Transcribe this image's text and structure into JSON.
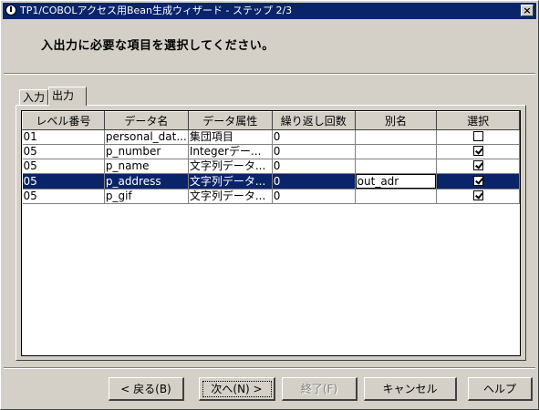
{
  "window": {
    "title": "TP1/COBOLアクセス用Bean生成ウィザード - ステップ 2/3",
    "close_label": "×"
  },
  "instruction": "入出力に必要な項目を選択してください。",
  "tabs": [
    {
      "label": "入力",
      "active": false
    },
    {
      "label": "出力",
      "active": true
    }
  ],
  "table": {
    "columns": [
      "レベル番号",
      "データ名",
      "データ属性",
      "繰り返し回数",
      "別名",
      "選択"
    ],
    "rows": [
      {
        "level": "01",
        "name": "personal_dat...",
        "attr": "集団項目",
        "repeat": "0",
        "alias": "",
        "checked": false
      },
      {
        "level": "05",
        "name": "p_number",
        "attr": "Integerデー...",
        "repeat": "0",
        "alias": "",
        "checked": true
      },
      {
        "level": "05",
        "name": "p_name",
        "attr": "文字列データ...",
        "repeat": "0",
        "alias": "",
        "checked": true
      },
      {
        "level": "05",
        "name": "p_address",
        "attr": "文字列データ...",
        "repeat": "0",
        "alias": "out_adr",
        "checked": true,
        "selected": true
      },
      {
        "level": "05",
        "name": "p_gif",
        "attr": "文字列データ...",
        "repeat": "0",
        "alias": "",
        "checked": true
      }
    ]
  },
  "buttons": {
    "back": "< 戻る(B)",
    "next": "次へ(N) >",
    "finish": "終了(F)",
    "cancel": "キャンセル",
    "help": "ヘルプ"
  }
}
